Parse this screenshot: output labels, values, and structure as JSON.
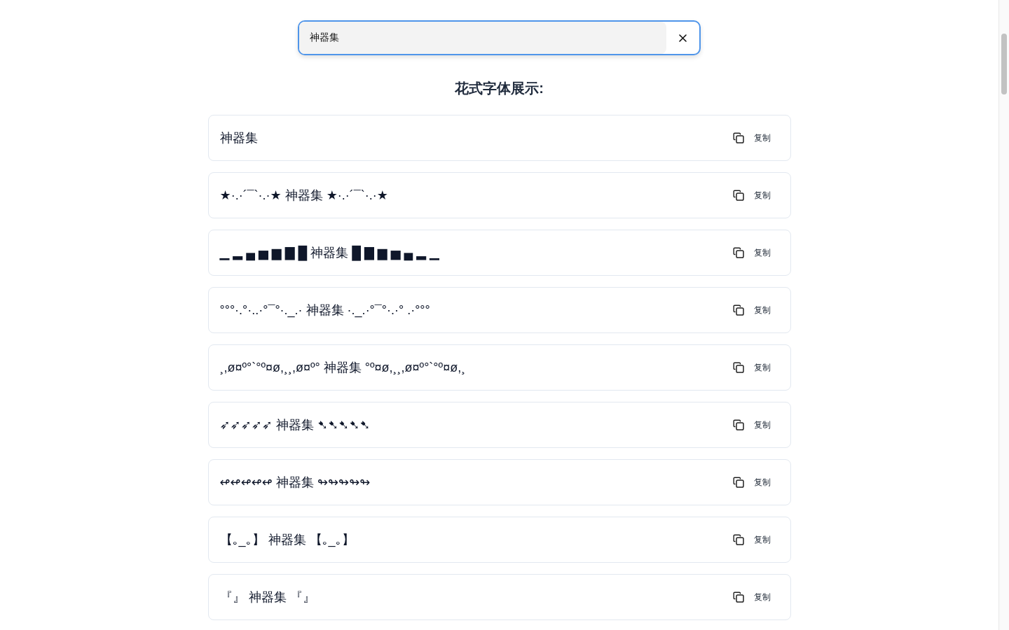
{
  "search": {
    "value": "神器集"
  },
  "heading": "花式字体展示:",
  "results": [
    {
      "text": "神器集",
      "copy_label": "复制"
    },
    {
      "text": "★·.·´¯`·.·★ 神器集 ★·.·´¯`·.·★",
      "copy_label": "复制"
    },
    {
      "text": "▁ ▂ ▄ ▅ ▆ ▇ █ 神器集 █ ▇ ▆ ▅ ▄ ▂ ▁",
      "copy_label": "复制"
    },
    {
      "text": "°°°·.°·..·°¯°·._.· 神器集 ·._.·°¯°·.·° .·°°°",
      "copy_label": "复制"
    },
    {
      "text": "¸,ø¤º°`°º¤ø,¸¸,ø¤º° 神器集 °º¤ø,¸¸,ø¤º°`°º¤ø,¸",
      "copy_label": "复制"
    },
    {
      "text": "➶➶➶➶➶ 神器集 ➷➷➷➷➷",
      "copy_label": "复制"
    },
    {
      "text": "↫↫↫↫↫ 神器集 ↬↬↬↬↬",
      "copy_label": "复制"
    },
    {
      "text": "【｡_｡】 神器集 【｡_｡】",
      "copy_label": "复制"
    },
    {
      "text": "『』 神器集 『』",
      "copy_label": "复制"
    }
  ]
}
